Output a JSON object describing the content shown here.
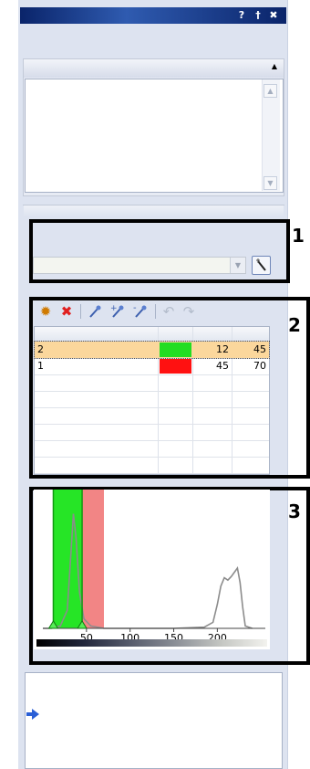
{
  "window": {
    "help_label": "?",
    "pin_label": "†",
    "close_label": "✖"
  },
  "histogram": {
    "type": "line",
    "xlim": [
      0,
      255
    ],
    "x_ticks": [
      "50",
      "100",
      "150",
      "200"
    ],
    "tick_values": [
      50,
      100,
      150,
      200
    ],
    "ranges": [
      {
        "color": "#00e000",
        "from": 12,
        "to": 45
      },
      {
        "color": "#f07070",
        "from": 45,
        "to": 70
      }
    ],
    "markers": [
      12,
      45
    ],
    "curve": [
      [
        0,
        0
      ],
      [
        10,
        0
      ],
      [
        20,
        0.02
      ],
      [
        28,
        0.15
      ],
      [
        32,
        0.6
      ],
      [
        35,
        0.95
      ],
      [
        38,
        0.75
      ],
      [
        42,
        0.3
      ],
      [
        47,
        0.08
      ],
      [
        55,
        0.02
      ],
      [
        70,
        0
      ],
      [
        150,
        0
      ],
      [
        185,
        0.01
      ],
      [
        195,
        0.05
      ],
      [
        200,
        0.2
      ],
      [
        204,
        0.35
      ],
      [
        208,
        0.42
      ],
      [
        212,
        0.4
      ],
      [
        216,
        0.43
      ],
      [
        220,
        0.47
      ],
      [
        223,
        0.5
      ],
      [
        226,
        0.38
      ],
      [
        229,
        0.18
      ],
      [
        232,
        0.02
      ],
      [
        240,
        0
      ]
    ],
    "gradient": [
      "#000000",
      "#20253a",
      "#555a6a",
      "#8a8e96",
      "#c4c6c2",
      "#f2f2ee"
    ]
  },
  "annotations": {
    "callout_1": "1",
    "callout_2": "2",
    "callout_3": "3"
  },
  "toolbar": {
    "items": [
      {
        "icon": "new-icon",
        "color": "#d07a00"
      },
      {
        "icon": "delete-icon",
        "color": "#e02020"
      },
      {
        "icon": "pin-icon"
      },
      {
        "icon": "pin-add-icon"
      },
      {
        "icon": "pin-remove-icon"
      },
      {
        "icon": "undo-icon",
        "enabled": false
      },
      {
        "icon": "redo-icon",
        "enabled": false
      }
    ]
  },
  "ranges_table": {
    "rows": [
      {
        "label": "2",
        "color": "#22dd22",
        "from": "12",
        "to": "45",
        "selected": true
      },
      {
        "label": "1",
        "color": "#ff1111",
        "from": "45",
        "to": "70",
        "selected": false
      }
    ]
  }
}
